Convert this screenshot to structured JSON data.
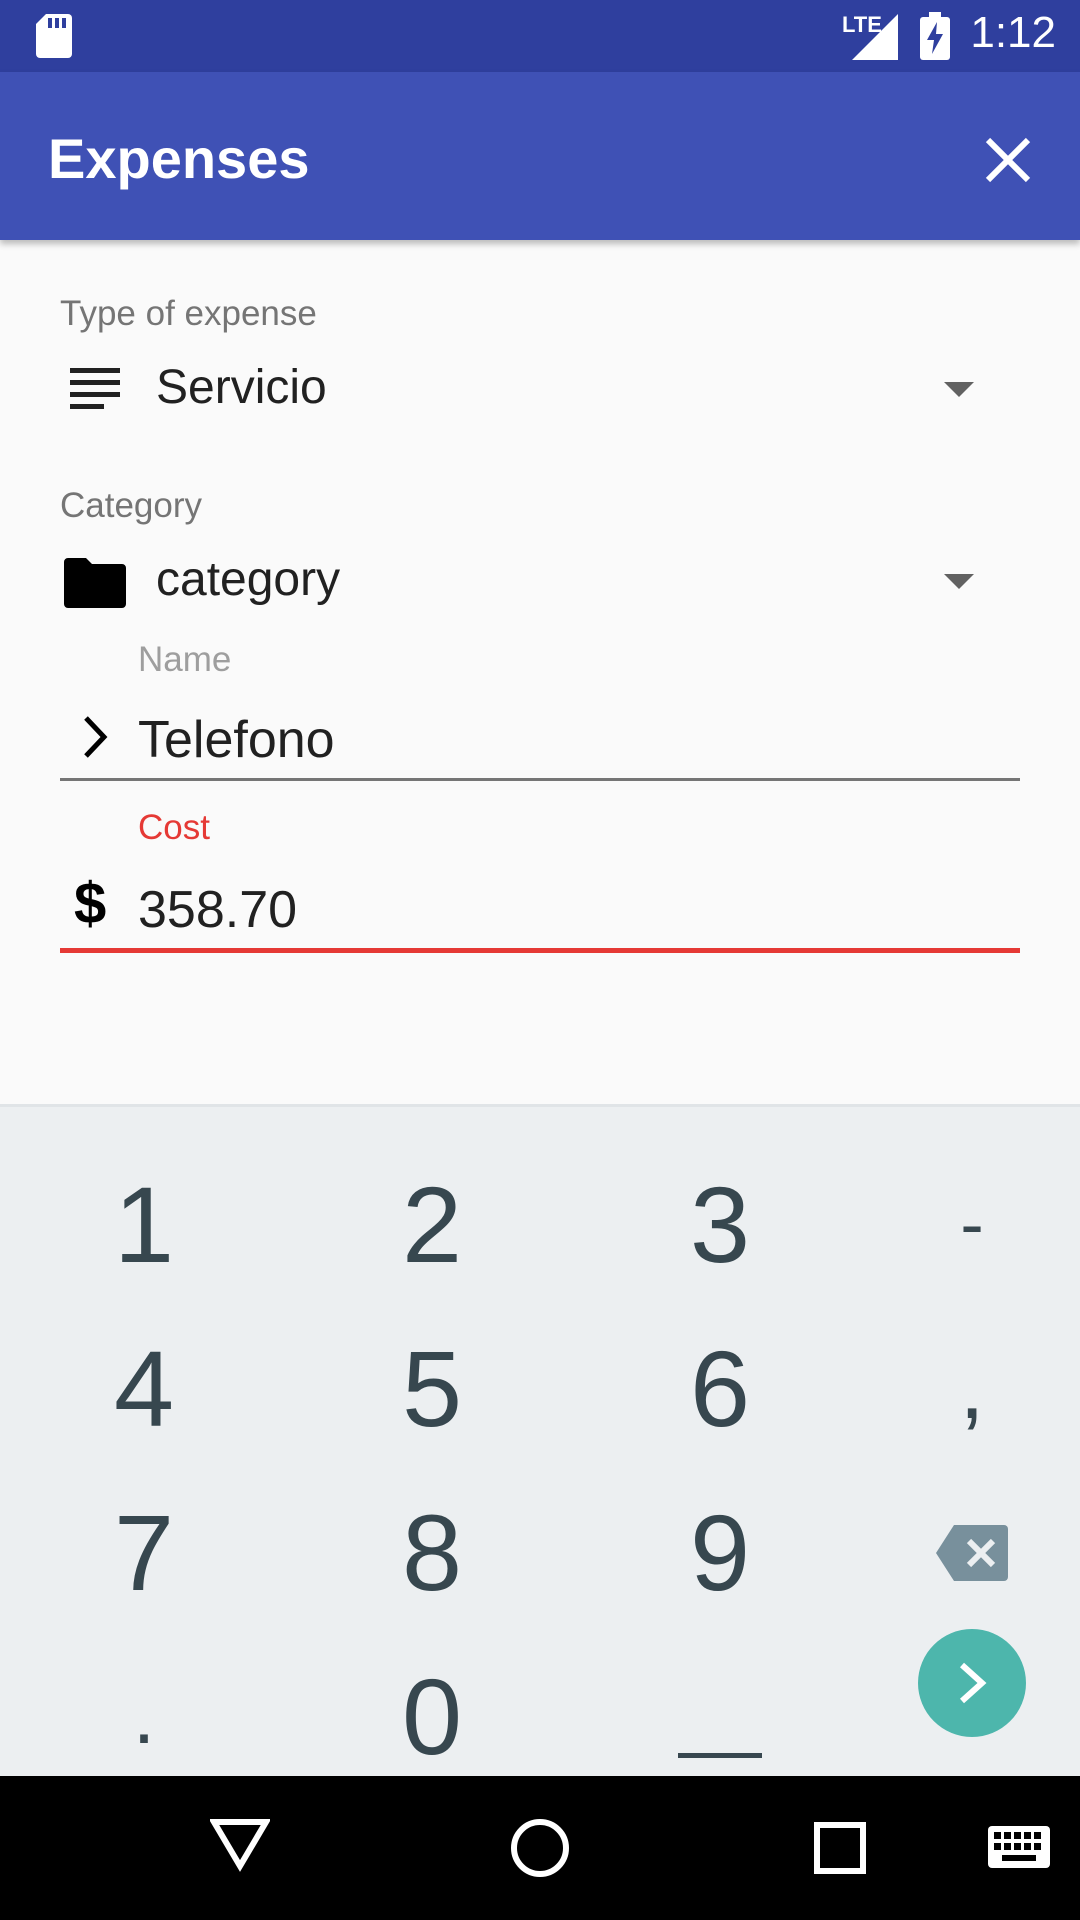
{
  "status_bar": {
    "time": "1:12",
    "network": "LTE",
    "icons": [
      "sd-card-icon",
      "signal-icon",
      "battery-charging-icon"
    ]
  },
  "app_bar": {
    "title": "Expenses",
    "close_icon": "close-icon"
  },
  "form": {
    "type_label": "Type of expense",
    "type_value": "Servicio",
    "category_label": "Category",
    "category_value": "category",
    "name_label": "Name",
    "name_value": "Telefono",
    "cost_label": "Cost",
    "cost_symbol": "$",
    "cost_value": "358.70",
    "cost_color": "#e53935"
  },
  "keyboard": {
    "keys": [
      "1",
      "2",
      "3",
      "-",
      "4",
      "5",
      "6",
      ",",
      "7",
      "8",
      "9",
      "⌫",
      ".",
      "0",
      "_",
      "›"
    ],
    "enter_color": "#4db6ac"
  },
  "nav_bar": {
    "icons": [
      "back-icon",
      "home-icon",
      "recents-icon",
      "keyboard-icon"
    ]
  }
}
